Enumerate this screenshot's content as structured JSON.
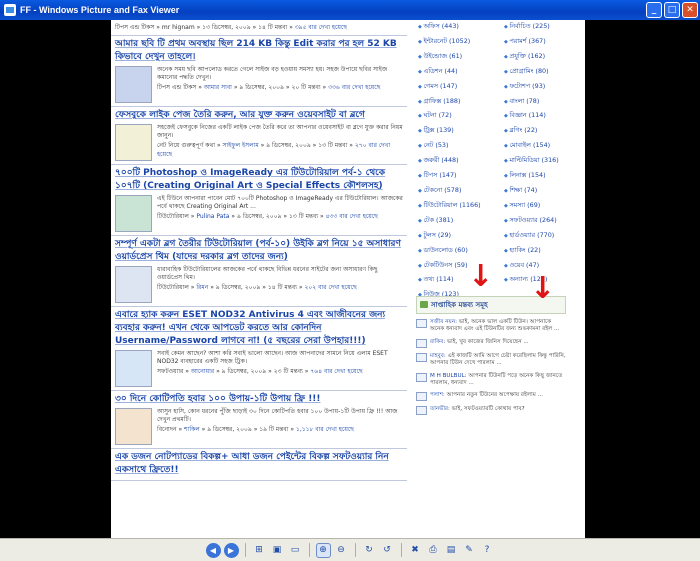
{
  "window": {
    "title": "FF - Windows Picture and Fax Viewer",
    "min_label": "_",
    "max_label": "□",
    "close_label": "✕"
  },
  "posts": [
    {
      "title": "",
      "excerpt": "",
      "category": "টিপস এন্ড টিকস",
      "author": "mr hignam",
      "date": "১৩ ডিসেম্বর, ২০০৯",
      "comments": "১৪ টি মন্তব্য",
      "views": "৩৯৫ বার দেখা হয়েছে"
    },
    {
      "title": "আমার ছবি টি প্রথম অবস্থায় ছিল 214 KB কিন্তু Edit করার পর হল 52 KB কিভাবে দেখুন তাহলে।",
      "excerpt": "অনেক সময় ছবি আপলোড করতে গেলে সাইজ বড় হওয়ায় সমস্যা হয়। সহজ উপায়ে ছবির সাইজ কমানোর পদ্ধতি দেখুন।",
      "category": "টিপস এন্ড টিকস",
      "author": "আমার সাবা",
      "date": "৯ ডিসেম্বর, ২০০৯",
      "comments": "২০ টি মন্তব্য",
      "views": "৩৩৬ বার দেখা হয়েছে"
    },
    {
      "title": "ফেসবুকে লাইক পেজ তৈরি করুন, আর যুক্ত করুন ওয়েবসাইট বা ব্লগে",
      "excerpt": "সহজেই ফেসবুকে নিজের একটি লাইক পেজ তৈরি করে তা আপনার ওয়েবসাইট বা ব্লগে যুক্ত করার নিয়ম জানুন।",
      "category": "নেট নিয়ে গুরুত্বপূর্ণ কথা",
      "author": "সাইফুল ইসলাম",
      "date": "৯ ডিসেম্বর, ২০০৯",
      "comments": "১৩ টি মন্তব্য",
      "views": "২৭০ বার দেখা হয়েছে"
    },
    {
      "title": "৭০০টি Photoshop ও ImageReady এর টিউটোরিয়াল পর্ব-১ থেকে ১০৭টি (Creating Original Art ও Special Effects কৌশলসহ)",
      "excerpt": "এই টিউনে আপনারা পাবেন মোট ৭০০টি Photoshop ও ImageReady এর টিউটোরিয়াল। আজকের পর্বে থাকছে Creating Original Art ...",
      "category": "টিউটোরিয়াল",
      "author": "Pulina Pata",
      "date": "৯ ডিসেম্বর, ২০০৯",
      "comments": "১৩ টি মন্তব্য",
      "views": "৪৩৩ বার দেখা হয়েছে"
    },
    {
      "title": "সম্পূর্ণ একটা ব্লগ তৈরীর টিউটোরিয়াল (পর্ব-১০) উইকি ব্লগ নিয়ে ১৫ অসাধারণ ওয়ার্ডপ্রেস থিম (যাদের দরকার ব্লগ তাদের জন্য)",
      "excerpt": "ধারাবাহিক টিউটোরিয়ালের আজকের পর্বে থাকছে বিভিন্ন ধরনের সাইটের জন্য অসাধারণ কিছু ওয়ার্ডপ্রেস থিম।",
      "category": "টিউটোরিয়াল",
      "author": "রিমন",
      "date": "৯ ডিসেম্বর, ২০০৯",
      "comments": "১৪ টি মন্তব্য",
      "views": "২০২ বার দেখা হয়েছে"
    },
    {
      "title": "এবারে হ্যাক করুন ESET NOD32 Antivirus 4 এবং আজীবনের জন্য ব্যবহার করুন! এখন থেকে আপডেট করতে আর কোনদিন Username/Password লাগবে না! (৫ বছরের সেরা উপহার!!!)",
      "excerpt": "সবাই কেমন আছেন? আশা করি সবাই ভালো আছেন। আজ আপনাদের সামনে নিয়ে এলাম ESET NOD32 ব্যবহারের একটি সহজ ট্রিক।",
      "category": "সফটওয়্যার",
      "author": "আনোয়ার",
      "date": "৯ ডিসেম্বর, ২০০৯",
      "comments": "২৩ টি মন্তব্য",
      "views": "৭৬৪ বার দেখা হয়েছে"
    },
    {
      "title": "৩০ দিনে কোটিপতি হবার ১০০ উপায়-১টি উপায় ফ্রি !!!",
      "excerpt": "আসুন হাসি, কোন ধরনের পুঁজি ছাড়াই ৩০ দিনে কোটিপতি হবার ১০০ উপায়-১টি উপায় ফ্রি !!! আজ দেখুন প্রথমটি।",
      "category": "বিনোদন",
      "author": "শাকিল",
      "date": "৯ ডিসেম্বর, ২০০৯",
      "comments": "১৯ টি মন্তব্য",
      "views": "১,১১৮ বার দেখা হয়েছে"
    },
    {
      "title": "এক ডজন নোটপ্যাডের বিকল্প+ আধা ডজন পেইন্টের বিকল্প সফটওয়্যার নিন একসাথে ফ্রিতে!!",
      "excerpt": "",
      "category": "",
      "author": "",
      "date": "",
      "comments": "",
      "views": ""
    }
  ],
  "sidebar": {
    "categories": [
      "অফিস (443)",
      "ইন্টারনেট (1052)",
      "উইন্ডোজ (61)",
      "এডিশন (44)",
      "গেমস (147)",
      "গ্রাফিক্স (188)",
      "ঘটনা (72)",
      "ট্রিক্স (139)",
      "নেট (53)",
      "জরুরী (448)",
      "টিপস (147)",
      "টেকনো (578)",
      "টিউটোরিয়াল (1166)",
      "টেক (381)",
      "টুলস (29)",
      "ডাউনলোড (60)",
      "টেকটিউনস (59)",
      "তথ্য (114)",
      "নিউজ (123)",
      "নির্বাচিত (225)",
      "পরামর্শ (367)",
      "প্রযুক্তি (162)",
      "প্রোগ্রামিং (80)",
      "ফটোশপ (93)",
      "বাংলা (78)",
      "বিজ্ঞান (114)",
      "ব্লগিং (22)",
      "মোবাইল (154)",
      "মাল্টিমিডিয়া (316)",
      "লিনাক্স (154)",
      "শিক্ষা (74)",
      "সমস্যা (69)",
      "সফটওয়্যার (264)",
      "হার্ডওয়্যার (770)",
      "হ্যাকিং (22)",
      "ওয়েব (47)",
      "অন্যান্য (129)",
      ""
    ],
    "weekly_title": "সাপ্তাহিক মন্তব্য সমূহ",
    "comments": [
      {
        "name": "সজীব নয়ন:",
        "text": "ভাই, অনেক ভাল একটি টিউন। আপনাকে অনেক ধন্যবাদ এবং এই টিউনটির জন্য শুভকামনা রইল ..."
      },
      {
        "name": "রাকিব:",
        "text": "ভাই, খুব কাজের জিনিস দিয়েছেন ..."
      },
      {
        "name": "মাহবুব:",
        "text": "এই কাজটি আমি আগে চেষ্টা করেছিলাম কিন্তু পারিনি, আপনার টিউন দেখে পারলাম ..."
      },
      {
        "name": "M H BULBUL:",
        "text": "আপনার টিউনটি পড়ে অনেক কিছু জানতে পারলাম, ধন্যবাদ ..."
      },
      {
        "name": "পলাশ:",
        "text": "আপনার নতুন টিউনের অপেক্ষায় রইলাম ..."
      },
      {
        "name": "তানভীর:",
        "text": "ভাই, সফটওয়্যারটি কোথায় পাব?"
      }
    ]
  },
  "toolbar": {
    "buttons": [
      {
        "name": "previous-image-button",
        "glyph": "◀"
      },
      {
        "name": "next-image-button",
        "glyph": "▶"
      },
      {
        "name": "best-fit-button",
        "glyph": "⊞"
      },
      {
        "name": "actual-size-button",
        "glyph": "▣"
      },
      {
        "name": "slideshow-button",
        "glyph": "▭"
      },
      {
        "name": "zoom-in-button",
        "glyph": "⊕"
      },
      {
        "name": "zoom-out-button",
        "glyph": "⊖"
      },
      {
        "name": "rotate-clockwise-button",
        "glyph": "↻"
      },
      {
        "name": "rotate-counterclockwise-button",
        "glyph": "↺"
      },
      {
        "name": "delete-button",
        "glyph": "✖"
      },
      {
        "name": "print-button",
        "glyph": "⎙"
      },
      {
        "name": "copy-to-button",
        "glyph": "▤"
      },
      {
        "name": "edit-button",
        "glyph": "✎"
      },
      {
        "name": "help-button",
        "glyph": "?"
      }
    ]
  },
  "colors": {
    "accent": "#1a45a8",
    "titlebar": "#0a50d0",
    "arrow": "#e01414"
  }
}
